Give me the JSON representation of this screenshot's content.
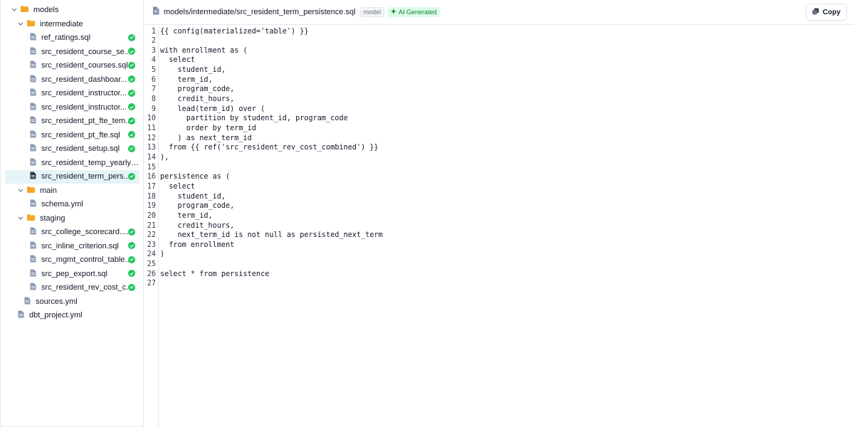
{
  "sidebar": {
    "models": "models",
    "intermediate": "intermediate",
    "intermediate_files": [
      {
        "name": "ref_ratings.sql",
        "status": "ok"
      },
      {
        "name": "src_resident_course_se...",
        "status": "ok"
      },
      {
        "name": "src_resident_courses.sql",
        "status": "ok"
      },
      {
        "name": "src_resident_dashboar...",
        "status": "ok"
      },
      {
        "name": "src_resident_instructor...",
        "status": "ok"
      },
      {
        "name": "src_resident_instructor...",
        "status": "ok"
      },
      {
        "name": "src_resident_pt_fte_tem...",
        "status": "ok"
      },
      {
        "name": "src_resident_pt_fte.sql",
        "status": "ok"
      },
      {
        "name": "src_resident_setup.sql",
        "status": "ok"
      },
      {
        "name": "src_resident_temp_yearly_...",
        "status": ""
      },
      {
        "name": "src_resident_term_pers...",
        "status": "ok"
      }
    ],
    "main": "main",
    "main_files": [
      "schema.yml"
    ],
    "staging": "staging",
    "staging_files": [
      {
        "name": "src_college_scorecard....",
        "status": "ok"
      },
      {
        "name": "src_inline_criterion.sql",
        "status": "ok"
      },
      {
        "name": "src_mgmt_control_table...",
        "status": "ok"
      },
      {
        "name": "src_pep_export.sql",
        "status": "ok"
      },
      {
        "name": "src_resident_rev_cost_c...",
        "status": "ok"
      }
    ],
    "sources": "sources.yml",
    "project": "dbt_project.yml"
  },
  "header": {
    "path": "models/intermediate/src_resident_term_persistence.sql",
    "model_badge": "model",
    "ai_badge": "AI Generated",
    "copy_label": "Copy"
  },
  "code_lines": [
    "{{ config(materialized='table') }}",
    "",
    "with enrollment as (",
    "  select",
    "    student_id,",
    "    term_id,",
    "    program_code,",
    "    credit_hours,",
    "    lead(term_id) over (",
    "      partition by student_id, program_code",
    "      order by term_id",
    "    ) as next_term_id",
    "  from {{ ref('src_resident_rev_cost_combined') }}",
    "),",
    "",
    "persistence as (",
    "  select",
    "    student_id,",
    "    program_code,",
    "    term_id,",
    "    credit_hours,",
    "    next_term_id is not null as persisted_next_term",
    "  from enrollment",
    ")",
    "",
    "select * from persistence",
    ""
  ],
  "colors": {
    "accent_green": "#22c55e",
    "folder": "#f5a623",
    "selected_row": "#e6f4f8"
  }
}
